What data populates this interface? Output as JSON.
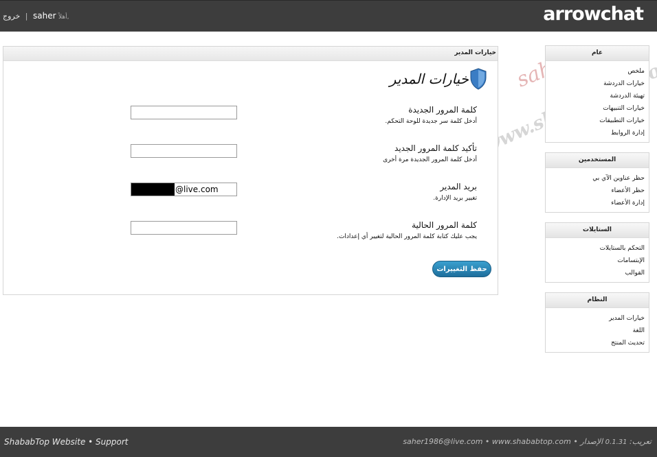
{
  "header": {
    "logo": "arrowchat",
    "logout_label": "خروج",
    "separator": "|",
    "username": "saher",
    "greeting": "أهلاً,"
  },
  "main": {
    "panel_title": "خيارات المدير",
    "page_title": "خيارات المدير",
    "fields": [
      {
        "label": "كلمة المرور الجديدة",
        "hint": "أدخل كلمة سر جديدة للوحة التحكم.",
        "value": ""
      },
      {
        "label": "تأكيد كلمة المرور الجديد",
        "hint": "أدخل كلمة المرور الجديدة مرة أخرى",
        "value": ""
      },
      {
        "label": "بريد المدير",
        "hint": "تغيير بريد الإدارة.",
        "value": "@live.com"
      },
      {
        "label": "كلمة المرور الحالية",
        "hint": "يجب عليك كتابة كلمة المرور الحالية لتغيير أي إعدادات.",
        "value": ""
      }
    ],
    "save_label": "حفظ التغييرات"
  },
  "sidebar": {
    "general": {
      "title": "عام",
      "items": [
        "ملخص",
        "خيارات الدردشة",
        "تهيئة الدردشة",
        "خيارات التنبيهات",
        "خيارات التطبيقات",
        "إدارة الروابط"
      ]
    },
    "users": {
      "title": "المستخدمين",
      "items": [
        "حظر عناوين الآي بي",
        "حظر الأعضاء",
        "إدارة الأعضاء"
      ]
    },
    "styles": {
      "title": "الستايلات",
      "items": [
        "التحكم بالستايلات",
        "الإبتسامات",
        "القوالب"
      ]
    },
    "system": {
      "title": "النظام",
      "items": [
        "خيارات المدير",
        "اللغة",
        "تحديث المنتج"
      ]
    }
  },
  "watermark": {
    "name": "saher",
    "site": "www.shababtop.com"
  },
  "footer": {
    "left": "ShababTop Website • Support",
    "right_contact": "saher1986@live.com • www.shababtop.com • تعريب:",
    "version": "0.1.31",
    "version_label": "الإصدار"
  },
  "colors": {
    "bar_bg": "#3d3d3d",
    "button_top": "#3aa0cf",
    "button_bottom": "#1e6e9c",
    "shield": "#3b7dc4"
  }
}
